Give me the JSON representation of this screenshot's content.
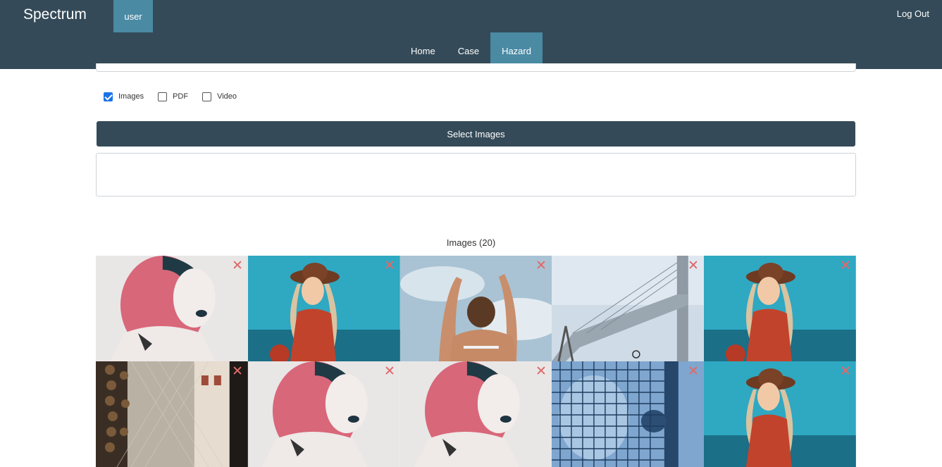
{
  "app": {
    "brand": "Spectrum",
    "user_label": "user",
    "logout_label": "Log Out"
  },
  "nav": {
    "tabs": [
      {
        "label": "Home",
        "active": false
      },
      {
        "label": "Case",
        "active": false
      },
      {
        "label": "Hazard",
        "active": true
      }
    ]
  },
  "filetypes": [
    {
      "label": "Images",
      "checked": true
    },
    {
      "label": "PDF",
      "checked": false
    },
    {
      "label": "Video",
      "checked": false
    }
  ],
  "upload": {
    "select_label": "Select Images"
  },
  "gallery": {
    "heading": "Images (20)",
    "tiles": [
      {
        "subject": "pink-hair-portrait"
      },
      {
        "subject": "woman-hat-teal"
      },
      {
        "subject": "arms-raised-sky"
      },
      {
        "subject": "bridge"
      },
      {
        "subject": "woman-hat-teal"
      },
      {
        "subject": "net-window"
      },
      {
        "subject": "pink-hair-portrait"
      },
      {
        "subject": "pink-hair-portrait"
      },
      {
        "subject": "blue-grid-fence"
      },
      {
        "subject": "woman-hat-teal"
      }
    ]
  },
  "colors": {
    "navbar": "#344a58",
    "active_tab": "#4a8aa3",
    "button": "#344a58",
    "remove_icon": "#e06a6a",
    "checkbox_checked": "#1a73e8"
  }
}
